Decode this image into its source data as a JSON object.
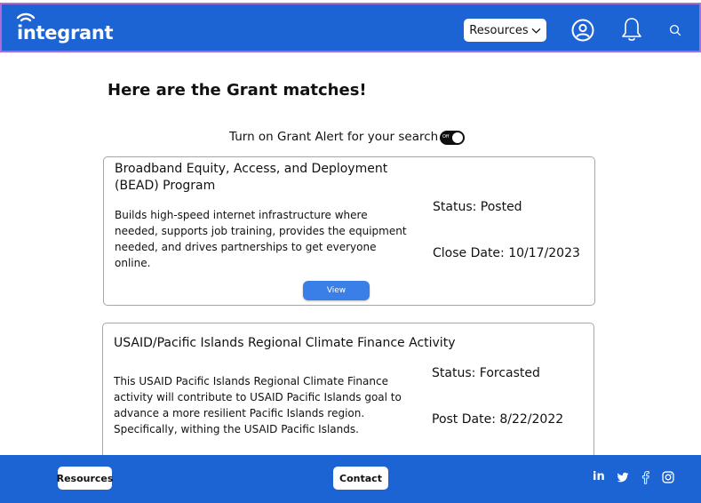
{
  "header": {
    "logo_text": "integrant",
    "resources_label": "Resources"
  },
  "main": {
    "title": "Here are the Grant matches!",
    "alert_text": "Turn on Grant Alert for your search",
    "toggle_state": "Off"
  },
  "cards": [
    {
      "title": "Broadband Equity, Access, and Deployment (BEAD) Program",
      "description": "Builds high-speed internet infrastructure where needed, supports job training, provides the equipment needed, and drives partnerships to get everyone online.",
      "status": "Status: Posted",
      "date": "Close Date: 10/17/2023",
      "view_label": "View"
    },
    {
      "title": "USAID/Pacific Islands Regional Climate Finance Activity",
      "description": "This USAID Pacific Islands Regional Climate Finance activity will contribute to USAID Pacific Islands goal to advance a more resilient Pacific Islands region. Specifically, withing the USAID Pacific Islands.",
      "status": "Status: Forcasted",
      "date": "Post Date: 8/22/2022"
    }
  ],
  "footer": {
    "resources_label": "Resources",
    "contact_label": "Contact",
    "social": [
      "linkedin-icon",
      "twitter-icon",
      "facebook-icon",
      "instagram-icon"
    ],
    "linkedin_text": "in"
  },
  "colors": {
    "brand_blue": "#1c63d3",
    "button_blue": "#3a7ee8"
  }
}
